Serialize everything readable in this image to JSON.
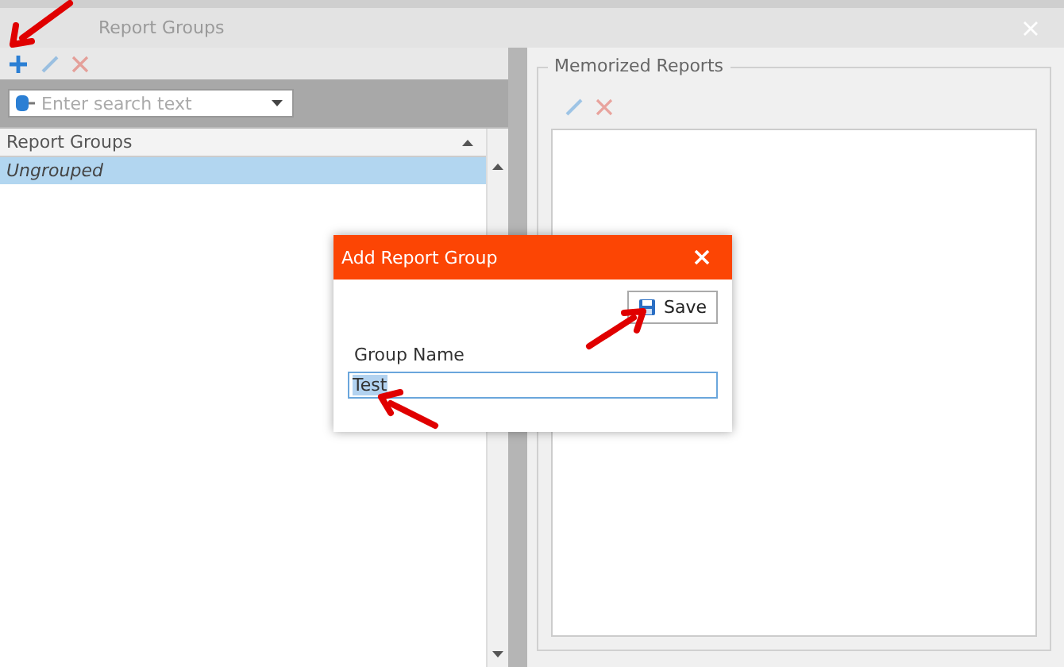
{
  "window": {
    "title": "Report Groups"
  },
  "left_toolbar": [
    {
      "kind": "add",
      "disabled": false
    },
    {
      "kind": "edit",
      "disabled": true
    },
    {
      "kind": "delete",
      "disabled": true
    }
  ],
  "search": {
    "placeholder": "Enter search text"
  },
  "grid": {
    "column": "Report Groups",
    "rows": [
      {
        "label": "Ungrouped",
        "selected": true
      }
    ]
  },
  "memorized_reports": {
    "title": "Memorized Reports",
    "toolbar": [
      {
        "kind": "edit",
        "disabled": true
      },
      {
        "kind": "delete",
        "disabled": true
      }
    ]
  },
  "dialog": {
    "title": "Add Report Group",
    "save": "Save",
    "field_label": "Group Name",
    "field_value": "Test",
    "value_selected": true
  },
  "annotations": [
    {
      "kind": "arrow"
    },
    {
      "kind": "arrow"
    },
    {
      "kind": "arrow"
    }
  ]
}
